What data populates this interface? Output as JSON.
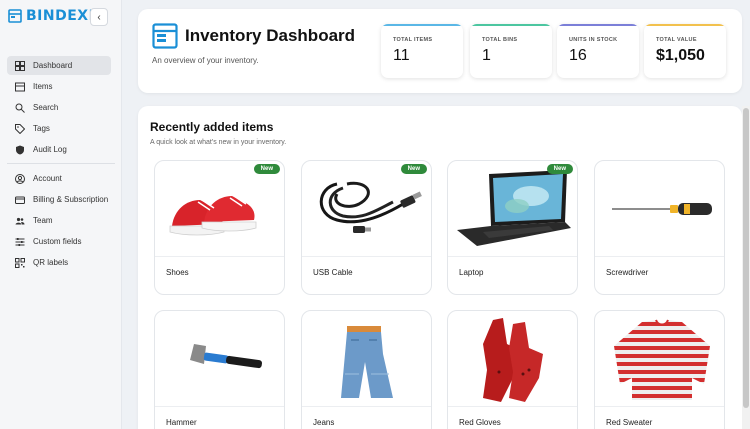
{
  "app": {
    "brand": "BINDEXR",
    "collapse_glyph": "‹"
  },
  "sidebar": {
    "primary": [
      {
        "label": "Dashboard",
        "icon": "dashboard-icon",
        "active": true
      },
      {
        "label": "Items",
        "icon": "items-icon"
      },
      {
        "label": "Search",
        "icon": "search-icon"
      },
      {
        "label": "Tags",
        "icon": "tag-icon"
      },
      {
        "label": "Audit Log",
        "icon": "shield-icon"
      }
    ],
    "secondary": [
      {
        "label": "Account",
        "icon": "account-icon"
      },
      {
        "label": "Billing & Subscription",
        "icon": "card-icon"
      },
      {
        "label": "Team",
        "icon": "team-icon"
      },
      {
        "label": "Custom fields",
        "icon": "sliders-icon"
      },
      {
        "label": "QR labels",
        "icon": "qr-icon"
      }
    ]
  },
  "header": {
    "title": "Inventory Dashboard",
    "subtitle": "An overview of your inventory.",
    "stats": [
      {
        "label": "TOTAL ITEMS",
        "value": "11",
        "accent": "#5ab7e6"
      },
      {
        "label": "TOTAL BINS",
        "value": "1",
        "accent": "#4cc6a0"
      },
      {
        "label": "UNITS IN STOCK",
        "value": "16",
        "accent": "#7b7fd8"
      },
      {
        "label": "TOTAL VALUE",
        "value": "$1,050",
        "accent": "#f2c14e"
      }
    ]
  },
  "recent": {
    "title": "Recently added items",
    "subtitle": "A quick look at what's new in your inventory.",
    "badge_label": "New",
    "items": [
      {
        "name": "Shoes",
        "new": true,
        "image": "red-sneakers-image"
      },
      {
        "name": "USB Cable",
        "new": true,
        "image": "usb-cable-image"
      },
      {
        "name": "Laptop",
        "new": true,
        "image": "laptop-image"
      },
      {
        "name": "Screwdriver",
        "new": false,
        "image": "screwdriver-image"
      },
      {
        "name": "Hammer",
        "new": false,
        "image": "hammer-image"
      },
      {
        "name": "Jeans",
        "new": false,
        "image": "jeans-image"
      },
      {
        "name": "Red Gloves",
        "new": false,
        "image": "red-gloves-image"
      },
      {
        "name": "Red Sweater",
        "new": false,
        "image": "striped-sweater-image"
      }
    ]
  },
  "colors": {
    "brand": "#1a8fd6",
    "new_badge": "#2f8a3b",
    "sidebar_active": "#e2e4e8"
  }
}
